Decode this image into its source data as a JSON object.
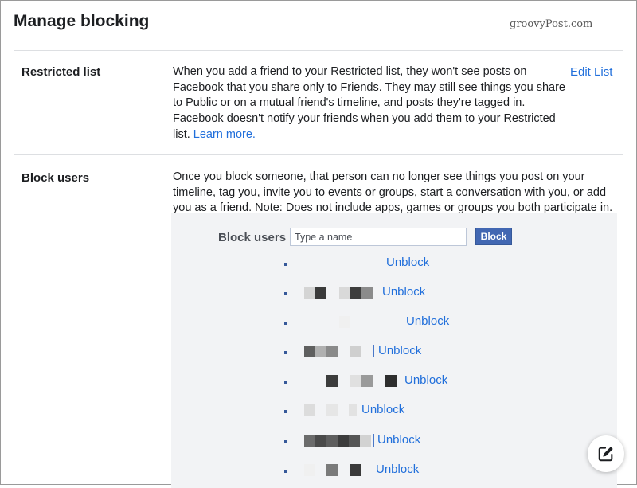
{
  "page": {
    "title": "Manage blocking",
    "watermark": "groovyPost.com"
  },
  "restricted": {
    "label": "Restricted list",
    "description": "When you add a friend to your Restricted list, they won't see posts on Facebook that you share only to Friends. They may still see things you share to Public or on a mutual friend's timeline, and posts they're tagged in. Facebook doesn't notify your friends when you add them to your Restricted list.",
    "learn_more": "Learn more.",
    "edit_list": "Edit List"
  },
  "block": {
    "label": "Block users",
    "description": "Once you block someone, that person can no longer see things you post on your timeline, tag you, invite you to events or groups, start a conversation with you, or add you as a friend. Note: Does not include apps, games or groups you both participate in.",
    "form_label": "Block users",
    "input_placeholder": "Type a name",
    "button_label": "Block",
    "unblock_label": "Unblock",
    "blocked_count": 8
  },
  "colors": {
    "accent": "#4267b2",
    "link": "#216fdb",
    "panel_bg": "#f2f3f5"
  },
  "icons": {
    "compose": "compose-icon"
  }
}
